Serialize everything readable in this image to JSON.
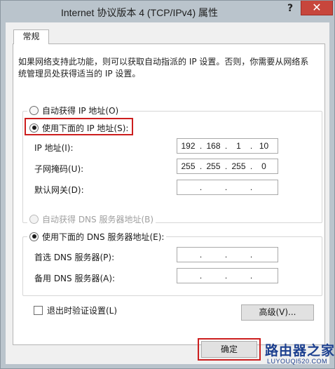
{
  "window": {
    "title": "Internet 协议版本 4 (TCP/IPv4) 属性",
    "help_glyph": "?",
    "close_glyph": "✕"
  },
  "tabs": [
    {
      "label": "常规"
    }
  ],
  "description": "如果网络支持此功能，则可以获取自动指派的 IP 设置。否则，你需要从网络系统管理员处获得适当的 IP 设置。",
  "ip": {
    "auto_label": "自动获得 IP 地址(O)",
    "manual_label": "使用下面的 IP 地址(S):",
    "address_label": "IP 地址(I):",
    "address": [
      "192",
      "168",
      "1",
      "10"
    ],
    "subnet_label": "子网掩码(U):",
    "subnet": [
      "255",
      "255",
      "255",
      "0"
    ],
    "gateway_label": "默认网关(D):",
    "gateway": [
      "",
      "",
      "",
      ""
    ]
  },
  "dns": {
    "auto_label": "自动获得 DNS 服务器地址(B)",
    "manual_label": "使用下面的 DNS 服务器地址(E):",
    "preferred_label": "首选 DNS 服务器(P):",
    "preferred": [
      "",
      "",
      "",
      ""
    ],
    "alternate_label": "备用 DNS 服务器(A):",
    "alternate": [
      "",
      "",
      "",
      ""
    ]
  },
  "validate_label": "退出时验证设置(L)",
  "advanced_label": "高级(V)...",
  "ok_label": "确定",
  "watermark": {
    "text": "路由器之家",
    "url": "LUYOUQI520.COM"
  },
  "colors": {
    "highlight": "#cc1e1e",
    "close": "#c7463c",
    "brand": "#1c3f8f"
  }
}
